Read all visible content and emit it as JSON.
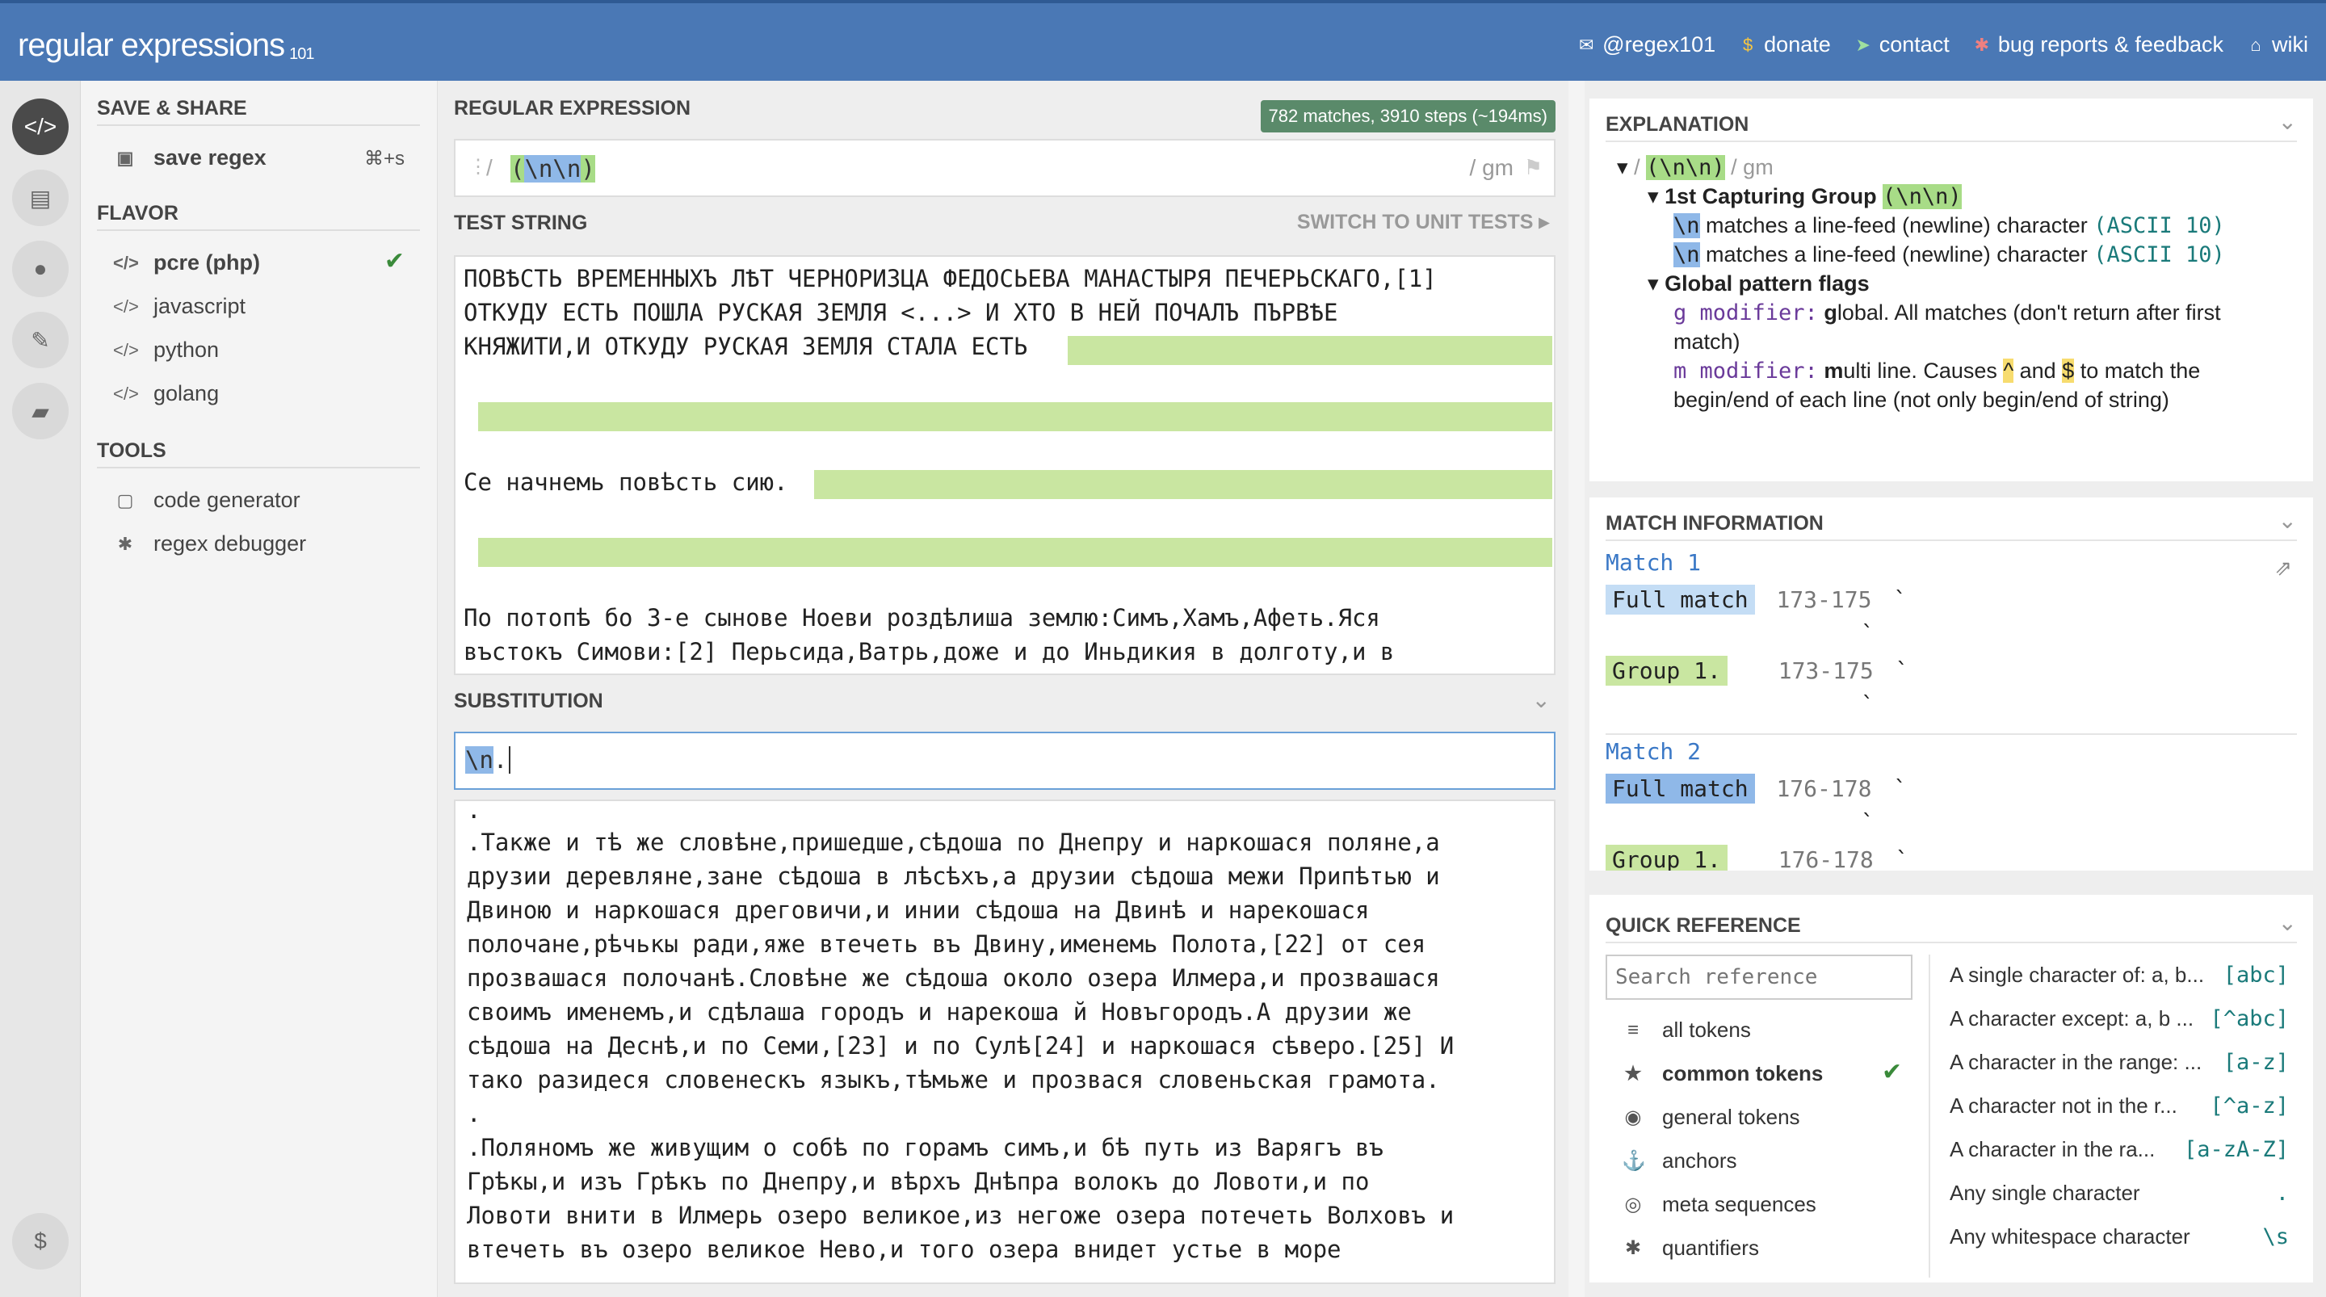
{
  "header": {
    "logo_main": "regular",
    "logo_thin": " expressions",
    "logo_sup": "101",
    "nav": [
      {
        "icon": "twitter-icon",
        "glyph": "✉",
        "label": "@regex101"
      },
      {
        "icon": "dollar-icon",
        "glyph": "$",
        "label": "donate"
      },
      {
        "icon": "paper-plane-icon",
        "glyph": "➤",
        "label": "contact"
      },
      {
        "icon": "bug-icon",
        "glyph": "✱",
        "label": "bug reports & feedback"
      },
      {
        "icon": "bank-icon",
        "glyph": "⌂",
        "label": "wiki"
      }
    ]
  },
  "sidebar": {
    "save_share_title": "Save & Share",
    "save_regex": "save regex",
    "save_shortcut": "⌘+s",
    "flavor_title": "Flavor",
    "flavors": [
      {
        "label": "pcre (php)",
        "selected": true
      },
      {
        "label": "javascript",
        "selected": false
      },
      {
        "label": "python",
        "selected": false
      },
      {
        "label": "golang",
        "selected": false
      }
    ],
    "tools_title": "Tools",
    "tools": [
      {
        "label": "code generator",
        "icon": "file-code-icon"
      },
      {
        "label": "regex debugger",
        "icon": "bug-icon"
      }
    ]
  },
  "regex": {
    "title": "Regular Expression",
    "match_info": "782 matches, 3910 steps (~194ms)",
    "delimiter": "/",
    "pattern_open": "(",
    "pattern_body": "\\n\\n",
    "pattern_close": ")",
    "flags": "/ gm"
  },
  "test_string": {
    "title": "Test String",
    "switch_label": "Switch to Unit Tests",
    "lines": [
      "ПОВѢСТЬ ВРЕМЕННЫХЪ ЛѢТ ЧЕРНОРИЗЦА ФЕДОСЬЕВА МАНАСТЫРЯ ПЕЧЕРЬСКАГО,[1]",
      "ОТКУДУ ЕСТЬ ПОШЛА РУСКАЯ ЗЕМЛЯ <...> И ХТО В НЕЙ ПОЧАЛЪ ПЪРВѢЕ",
      "КНЯЖИТИ,И ОТКУДУ РУСКАЯ ЗЕМЛЯ СТАЛА ЕСТЬ",
      "",
      "",
      "",
      "Се начнемь повѣсть сию.",
      "",
      "",
      "",
      "По потопѣ бо 3-е сынове Ноеви роздѣлиша землю:Симъ,Хамъ,Афеть.Яся",
      "въстокъ Симови:[2] Перьсида,Ватрь,доже и до Иньдикия в долготу,и в"
    ]
  },
  "substitution": {
    "title": "Substitution",
    "token": "\\n",
    "rest": ".",
    "result_lines": [
      ".",
      ".Также и тѣ же словѣне,пришедше,сѣдоша по Днепру и наркошася поляне,а",
      "друзии деревляне,зане сѣдоша в лѣсѣхъ,а друзии сѣдоша межи Припѣтью и",
      "Двиною и наркошася дреговичи,и инии сѣдоша на Двинѣ и нарекошася",
      "полочане,рѣчькы ради,яже втечеть въ Двину,именемь Полота,[22] от сея",
      "прозвашася полочанѣ.Словѣне же сѣдоша около озера Илмера,и прозвашася",
      "своимъ именемъ,и сдѣлаша городъ и нарекоша й Новъгородъ.А друзии же",
      "сѣдоша на Деснѣ,и по Семи,[23] и по Сулѣ[24] и наркошася сѣверо.[25] И",
      "тако разидеся словенескъ языкъ,тѣмьже и прозвася словеньская грамота.",
      ".",
      ".Поляномъ же живущим о собѣ по горамъ симъ,и бѣ путь из Варягъ въ",
      "Грѣкы,и изъ Грѣкъ по Днепру,и вѣрхъ Днѣпра волокъ до Ловоти,и по",
      "Ловоти внити в Илмерь озеро великое,из негоже озера потечеть Волховъ и",
      "втечеть въ озеро великое Нево,и того озера внидет устье в море"
    ]
  },
  "explanation": {
    "title": "Explanation",
    "root_slash": "/",
    "root_pattern": "(\\n\\n)",
    "root_flags": "/ gm",
    "group_label": "1st Capturing Group",
    "group_pattern": "(\\n\\n)",
    "token1": "\\n",
    "token1_desc": " matches a line-feed (newline) character ",
    "token1_ascii": "(ASCII 10)",
    "token2": "\\n",
    "token2_desc": " matches a line-feed (newline) character ",
    "token2_ascii": "(ASCII 10)",
    "flags_label": "Global pattern flags",
    "g_mod": "g modifier:",
    "g_bold": " g",
    "g_desc_a": "lobal. All matches (don't return after first",
    "g_desc_b": "match)",
    "m_mod": "m modifier:",
    "m_bold": " m",
    "m_desc_a": "ulti line. Causes ",
    "m_caret": "^",
    "m_and": " and ",
    "m_dollar": "$",
    "m_desc_b": " to match the",
    "m_desc_c": "begin/end of each line (not only begin/end of string)"
  },
  "match_info": {
    "title": "Match Information",
    "matches": [
      {
        "name": "Match 1",
        "full_label": "Full match",
        "full_range": "173-175",
        "group_label": "Group 1.",
        "group_range": "173-175"
      },
      {
        "name": "Match 2",
        "full_label": "Full match",
        "full_range": "176-178",
        "group_label": "Group 1.",
        "group_range": "176-178"
      }
    ],
    "backtick": "`"
  },
  "quick_ref": {
    "title": "Quick Reference",
    "search_placeholder": "Search reference",
    "categories": [
      {
        "label": "all tokens",
        "icon": "database-icon",
        "glyph": "≡",
        "selected": false
      },
      {
        "label": "common tokens",
        "icon": "star-icon",
        "glyph": "★",
        "selected": true
      },
      {
        "label": "general tokens",
        "icon": "circle-dot-icon",
        "glyph": "◉",
        "selected": false
      },
      {
        "label": "anchors",
        "icon": "anchor-icon",
        "glyph": "⚓",
        "selected": false
      },
      {
        "label": "meta sequences",
        "icon": "lifebuoy-icon",
        "glyph": "◎",
        "selected": false
      },
      {
        "label": "quantifiers",
        "icon": "asterisk-icon",
        "glyph": "✱",
        "selected": false
      }
    ],
    "items": [
      {
        "desc": "A single character of: a, b...",
        "token": "[abc]"
      },
      {
        "desc": "A character except: a, b ...",
        "token": "[^abc]"
      },
      {
        "desc": "A character in the range: ...",
        "token": "[a-z]"
      },
      {
        "desc": "A character not in the r...",
        "token": "[^a-z]"
      },
      {
        "desc": "A character in the ra...",
        "token": "[a-zA-Z]"
      },
      {
        "desc": "Any single character",
        "token": "."
      },
      {
        "desc": "Any whitespace character",
        "token": "\\s"
      }
    ]
  },
  "colors": {
    "header_bg": "#4a78b5",
    "match_green": "#c9e6a1",
    "token_blue": "#8fb8e8",
    "group_green": "#a8dc87",
    "accent_teal": "#1a7a7a"
  }
}
